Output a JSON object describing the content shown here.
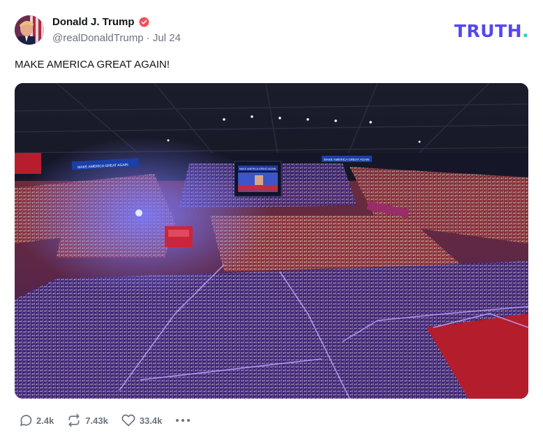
{
  "author": {
    "display_name": "Donald J. Trump",
    "handle": "@realDonaldTrump",
    "separator": "·",
    "date": "Jul 24",
    "verified_icon": "verified-badge-icon",
    "verified_color": "#f0505b"
  },
  "brand": {
    "name": "TRUTH",
    "dot": ".",
    "color": "#5448ee",
    "dot_color": "#2ad1c9"
  },
  "post": {
    "text": "MAKE AMERICA GREAT AGAIN!",
    "media": {
      "description_icon": "rally-photo",
      "banner_left": "MAKE AMERICA GREAT AGAIN",
      "banner_right": "MAKE AMERICA GREAT AGAIN",
      "screen_banner": "MAKE AMERICA GREAT AGAIN"
    }
  },
  "actions": {
    "replies": {
      "icon": "reply-icon",
      "count": "2.4k"
    },
    "retruths": {
      "icon": "retruth-icon",
      "count": "7.43k"
    },
    "likes": {
      "icon": "heart-icon",
      "count": "33.4k"
    },
    "more": {
      "icon": "more-icon"
    }
  }
}
